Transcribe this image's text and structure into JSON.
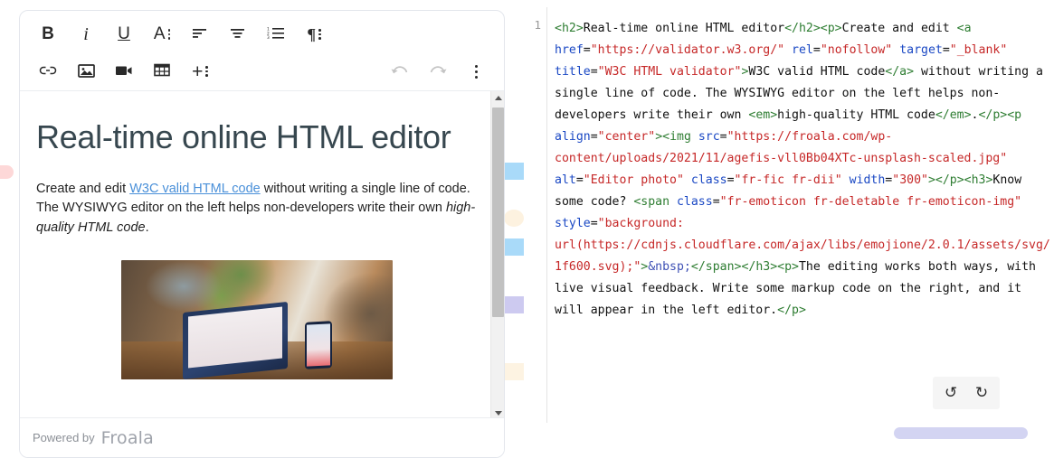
{
  "editor": {
    "toolbar_row1": [
      {
        "name": "bold-button",
        "label": "B",
        "kind": "bold"
      },
      {
        "name": "italic-button",
        "label": "i",
        "kind": "italic"
      },
      {
        "name": "underline-button",
        "label": "U",
        "kind": "underline"
      },
      {
        "name": "font-style-button",
        "label": "A",
        "kind": "more"
      },
      {
        "name": "align-left-button",
        "label": "",
        "kind": "align-left"
      },
      {
        "name": "align-center-button",
        "label": "",
        "kind": "align-center"
      },
      {
        "name": "ordered-list-button",
        "label": "",
        "kind": "ordered-list"
      },
      {
        "name": "paragraph-format-button",
        "label": "¶",
        "kind": "more"
      }
    ],
    "toolbar_row2": [
      {
        "name": "insert-link-button",
        "label": "",
        "kind": "link"
      },
      {
        "name": "insert-image-button",
        "label": "",
        "kind": "image"
      },
      {
        "name": "insert-video-button",
        "label": "",
        "kind": "video"
      },
      {
        "name": "insert-table-button",
        "label": "",
        "kind": "table"
      },
      {
        "name": "insert-more-button",
        "label": "+",
        "kind": "more"
      }
    ],
    "toolbar_right": [
      {
        "name": "undo-button",
        "label": "↶",
        "kind": "undo"
      },
      {
        "name": "redo-button",
        "label": "↷",
        "kind": "redo"
      },
      {
        "name": "more-options-button",
        "label": "",
        "kind": "kebab"
      }
    ],
    "document": {
      "heading": "Real-time online HTML editor",
      "para_before_link": "Create and edit ",
      "link_text": "W3C valid HTML code",
      "para_after_link": " without writing a single line of code. The WYSIWYG editor on the left helps non-developers write their own ",
      "emphasis_text": "high-quality HTML code",
      "para_end": ".",
      "image_alt": "Editor photo"
    },
    "footer": {
      "powered_by": "Powered by",
      "brand": "Froala"
    },
    "scrollbar": {
      "up_arrow": "▲",
      "down_arrow": "▼"
    }
  },
  "code_panel": {
    "line_number": "1",
    "tokens": [
      {
        "t": "tag",
        "v": "<h2>"
      },
      {
        "t": "txt",
        "v": "Real-time online HTML editor"
      },
      {
        "t": "tag",
        "v": "</h2><p>"
      },
      {
        "t": "txt",
        "v": "Create and edit "
      },
      {
        "t": "tag",
        "v": "<a "
      },
      {
        "t": "attr",
        "v": "href"
      },
      {
        "t": "txt",
        "v": "="
      },
      {
        "t": "str",
        "v": "\"https://validator.w3.org/\""
      },
      {
        "t": "txt",
        "v": " "
      },
      {
        "t": "attr",
        "v": "rel"
      },
      {
        "t": "txt",
        "v": "="
      },
      {
        "t": "str",
        "v": "\"nofollow\""
      },
      {
        "t": "txt",
        "v": " "
      },
      {
        "t": "attr",
        "v": "target"
      },
      {
        "t": "txt",
        "v": "="
      },
      {
        "t": "str",
        "v": "\"_blank\""
      },
      {
        "t": "txt",
        "v": " "
      },
      {
        "t": "attr",
        "v": "title"
      },
      {
        "t": "txt",
        "v": "="
      },
      {
        "t": "str",
        "v": "\"W3C HTML validator\""
      },
      {
        "t": "tag",
        "v": ">"
      },
      {
        "t": "txt",
        "v": "W3C valid HTML code"
      },
      {
        "t": "tag",
        "v": "</a>"
      },
      {
        "t": "txt",
        "v": " without writing a single line of code. The WYSIWYG editor on the left helps non-developers write their own "
      },
      {
        "t": "tag",
        "v": "<em>"
      },
      {
        "t": "txt",
        "v": "high-quality HTML code"
      },
      {
        "t": "tag",
        "v": "</em>"
      },
      {
        "t": "txt",
        "v": "."
      },
      {
        "t": "tag",
        "v": "</p><p "
      },
      {
        "t": "attr",
        "v": "align"
      },
      {
        "t": "txt",
        "v": "="
      },
      {
        "t": "str",
        "v": "\"center\""
      },
      {
        "t": "tag",
        "v": "><img "
      },
      {
        "t": "attr",
        "v": "src"
      },
      {
        "t": "txt",
        "v": "="
      },
      {
        "t": "str",
        "v": "\"https://froala.com/wp-content/uploads/2021/11/agefis-vll0Bb04XTc-unsplash-scaled.jpg\""
      },
      {
        "t": "txt",
        "v": " "
      },
      {
        "t": "attr",
        "v": "alt"
      },
      {
        "t": "txt",
        "v": "="
      },
      {
        "t": "str",
        "v": "\"Editor photo\""
      },
      {
        "t": "txt",
        "v": " "
      },
      {
        "t": "attr",
        "v": "class"
      },
      {
        "t": "txt",
        "v": "="
      },
      {
        "t": "str",
        "v": "\"fr-fic fr-dii\""
      },
      {
        "t": "txt",
        "v": " "
      },
      {
        "t": "attr",
        "v": "width"
      },
      {
        "t": "txt",
        "v": "="
      },
      {
        "t": "str",
        "v": "\"300\""
      },
      {
        "t": "tag",
        "v": "></p><h3>"
      },
      {
        "t": "txt",
        "v": "Know some code? "
      },
      {
        "t": "tag",
        "v": "<span "
      },
      {
        "t": "attr",
        "v": "class"
      },
      {
        "t": "txt",
        "v": "="
      },
      {
        "t": "str",
        "v": "\"fr-emoticon fr-deletable fr-emoticon-img\""
      },
      {
        "t": "txt",
        "v": " "
      },
      {
        "t": "attr",
        "v": "style"
      },
      {
        "t": "txt",
        "v": "="
      },
      {
        "t": "str",
        "v": "\"background: url(https://cdnjs.cloudflare.com/ajax/libs/emojione/2.0.1/assets/svg/1f600.svg);\""
      },
      {
        "t": "tag",
        "v": ">"
      },
      {
        "t": "ent",
        "v": "&nbsp;"
      },
      {
        "t": "tag",
        "v": "</span></h3><p>"
      },
      {
        "t": "txt",
        "v": "The editing works both ways, with live visual feedback. Write some markup code on the right, and it will appear in the left editor."
      },
      {
        "t": "tag",
        "v": "</p>"
      }
    ],
    "actions": [
      {
        "name": "code-undo-button",
        "label": "↺"
      },
      {
        "name": "code-redo-button",
        "label": "↻"
      }
    ]
  }
}
